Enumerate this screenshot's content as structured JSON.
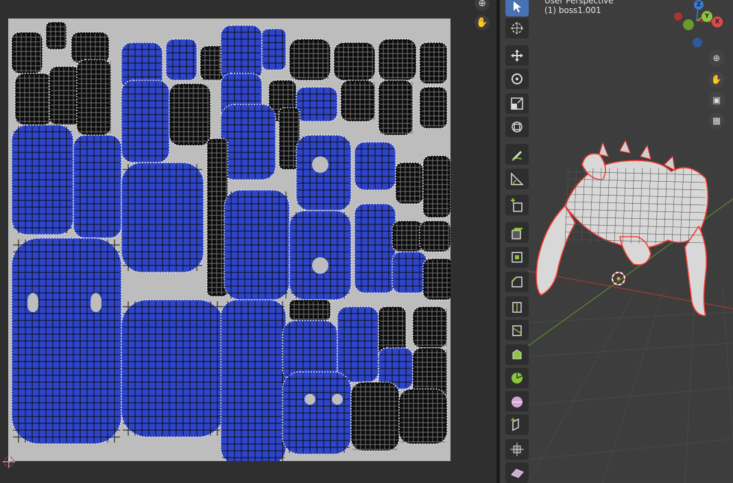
{
  "uv_editor": {
    "island_color": "#2f45c8",
    "grid_color": "#bdbdbd",
    "nav": {
      "zoom_icon": "zoom-icon",
      "pan_icon": "hand-pan-icon"
    }
  },
  "viewport": {
    "header_line1": "User Perspective",
    "header_line2": "(1) boss1.001",
    "gizmo": {
      "x_label": "X",
      "y_label": "Y",
      "z_label": "Z"
    },
    "nav": [
      "zoom-icon",
      "hand-pan-icon",
      "camera-icon",
      "grid-icon"
    ],
    "selection_color": "#ff3a2e"
  },
  "toolbar": {
    "tools": [
      {
        "name": "select-box-tool",
        "active": true
      },
      {
        "name": "cursor-tool",
        "active": false
      },
      {
        "name": "move-tool",
        "active": false
      },
      {
        "name": "rotate-tool",
        "active": false
      },
      {
        "name": "scale-tool",
        "active": false
      },
      {
        "name": "transform-tool",
        "active": false
      },
      {
        "name": "annotate-tool",
        "active": false
      },
      {
        "name": "measure-tool",
        "active": false
      },
      {
        "name": "add-cube-tool",
        "active": false
      },
      {
        "name": "extrude-tool",
        "active": false
      },
      {
        "name": "inset-tool",
        "active": false
      },
      {
        "name": "bevel-tool",
        "active": false
      },
      {
        "name": "loop-cut-tool",
        "active": false
      },
      {
        "name": "knife-tool",
        "active": false
      },
      {
        "name": "poly-build-tool",
        "active": false
      },
      {
        "name": "spin-tool",
        "active": false
      },
      {
        "name": "smooth-tool",
        "active": false
      },
      {
        "name": "edge-slide-tool",
        "active": false
      },
      {
        "name": "shrink-fatten-tool",
        "active": false
      },
      {
        "name": "shear-tool",
        "active": false
      }
    ]
  }
}
